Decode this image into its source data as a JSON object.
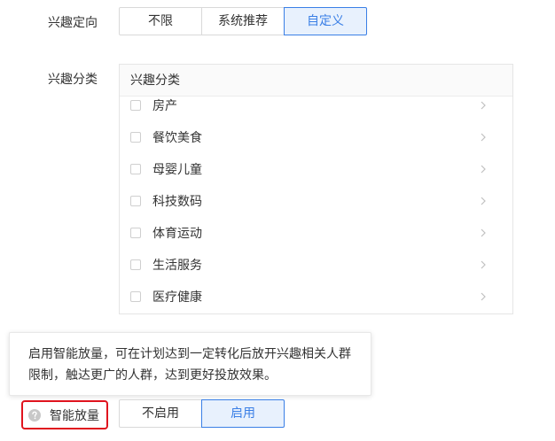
{
  "interest_targeting": {
    "label": "兴趣定向",
    "options": [
      "不限",
      "系统推荐",
      "自定义"
    ],
    "selected": "自定义"
  },
  "interest_category": {
    "label": "兴趣分类",
    "panel_header": "兴趣分类",
    "items": [
      "房产",
      "餐饮美食",
      "母婴儿童",
      "科技数码",
      "体育运动",
      "生活服务",
      "医疗健康"
    ]
  },
  "smart_expand": {
    "label": "智能放量",
    "help_icon": "question-circle-icon",
    "options": [
      "不启用",
      "启用"
    ],
    "selected": "启用",
    "tooltip": {
      "line1": "启用智能放量，可在计划达到一定转化后放开兴趣相关人群",
      "line2": "限制，触达更广的人群，达到更好投放效果。"
    }
  },
  "colors": {
    "accent": "#3a7fe6",
    "active_bg": "#e8f1fd",
    "highlight_border": "#e0141e"
  }
}
